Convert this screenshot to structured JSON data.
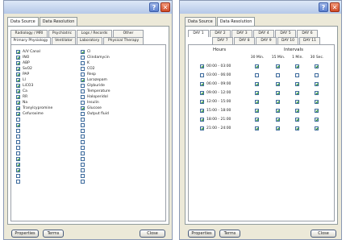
{
  "left": {
    "tabs": [
      "Data Source",
      "Data Resolution"
    ],
    "subtabs_row1": [
      "Radiology / MRI",
      "Psychiatric",
      "Logs / Records",
      "Other"
    ],
    "subtabs_row2": [
      "Primary Physiology",
      "Ventilator",
      "Laboratory",
      "Physical Therapy"
    ],
    "col1": [
      {
        "label": "A/V Canal",
        "checked": true
      },
      {
        "label": "INO",
        "checked": true
      },
      {
        "label": "ABP",
        "checked": true
      },
      {
        "label": "SvO2",
        "checked": true
      },
      {
        "label": "PAP",
        "checked": true
      },
      {
        "label": "LI",
        "checked": true
      },
      {
        "label": "LiCO3",
        "checked": true
      },
      {
        "label": "Ca",
        "checked": true
      },
      {
        "label": "RR",
        "checked": true
      },
      {
        "label": "Na",
        "checked": true
      },
      {
        "label": "Tranylcypromine",
        "checked": true
      },
      {
        "label": "Cefuroxime",
        "checked": true
      },
      {
        "label": "",
        "checked": false
      },
      {
        "label": "",
        "checked": true
      },
      {
        "label": "",
        "checked": false
      },
      {
        "label": "",
        "checked": false
      },
      {
        "label": "",
        "checked": false
      },
      {
        "label": "",
        "checked": false
      },
      {
        "label": "",
        "checked": false
      },
      {
        "label": "",
        "checked": true
      },
      {
        "label": "",
        "checked": true
      },
      {
        "label": "",
        "checked": true
      },
      {
        "label": "",
        "checked": false
      },
      {
        "label": "",
        "checked": false
      }
    ],
    "col2": [
      {
        "label": "Cl",
        "checked": true
      },
      {
        "label": "Clindamycin",
        "checked": false
      },
      {
        "label": "K",
        "checked": false
      },
      {
        "label": "CO2",
        "checked": false
      },
      {
        "label": "Resp",
        "checked": false
      },
      {
        "label": "Lorazepam",
        "checked": true
      },
      {
        "label": "Glyburide",
        "checked": false
      },
      {
        "label": "Temperature",
        "checked": false
      },
      {
        "label": "Haloperidol",
        "checked": false
      },
      {
        "label": "Insulin",
        "checked": false
      },
      {
        "label": "Glucose",
        "checked": true
      },
      {
        "label": "Output fluid",
        "checked": false
      },
      {
        "label": "",
        "checked": false
      },
      {
        "label": "",
        "checked": false
      },
      {
        "label": "",
        "checked": false
      },
      {
        "label": "",
        "checked": false
      },
      {
        "label": "",
        "checked": false
      },
      {
        "label": "",
        "checked": false
      },
      {
        "label": "",
        "checked": false
      },
      {
        "label": "",
        "checked": false
      },
      {
        "label": "",
        "checked": false
      },
      {
        "label": "",
        "checked": false
      },
      {
        "label": "",
        "checked": false
      },
      {
        "label": "",
        "checked": false
      }
    ],
    "buttons": {
      "properties": "Properties",
      "terms": "Terms",
      "close": "Close"
    }
  },
  "right": {
    "tabs": [
      "Data Source",
      "Data Resolution"
    ],
    "days_row1": [
      "DAY 1",
      "DAY 2",
      "DAY 3",
      "DAY 4",
      "DAY 5",
      "DAY 6"
    ],
    "days_row2": [
      "DAY 7",
      "DAY 8",
      "DAY 9",
      "DAY 10",
      "DAY 11"
    ],
    "hours_label": "Hours",
    "intervals_label": "Intervals",
    "interval_cols": [
      "30 Min.",
      "15 Min.",
      "1 Min.",
      "30 Sec."
    ],
    "rows": [
      {
        "time": "00:00 - 03:00",
        "on": true,
        "grid": [
          true,
          true,
          true,
          true
        ]
      },
      {
        "time": "03:00 - 06:00",
        "on": false,
        "grid": [
          false,
          false,
          false,
          false
        ]
      },
      {
        "time": "06:00 - 09:00",
        "on": true,
        "grid": [
          true,
          true,
          true,
          true
        ]
      },
      {
        "time": "09:00 - 12:00",
        "on": true,
        "grid": [
          true,
          true,
          true,
          true
        ]
      },
      {
        "time": "12:00 - 15:00",
        "on": true,
        "grid": [
          true,
          true,
          true,
          true
        ]
      },
      {
        "time": "15:00 - 18:00",
        "on": true,
        "grid": [
          true,
          true,
          true,
          true
        ]
      },
      {
        "time": "18:00 - 21:00",
        "on": true,
        "grid": [
          true,
          true,
          true,
          true
        ]
      },
      {
        "time": "21:00 - 24:00",
        "on": true,
        "grid": [
          true,
          true,
          true,
          true
        ]
      }
    ],
    "buttons": {
      "properties": "Properties",
      "terms": "Terms",
      "close": "Close"
    }
  }
}
